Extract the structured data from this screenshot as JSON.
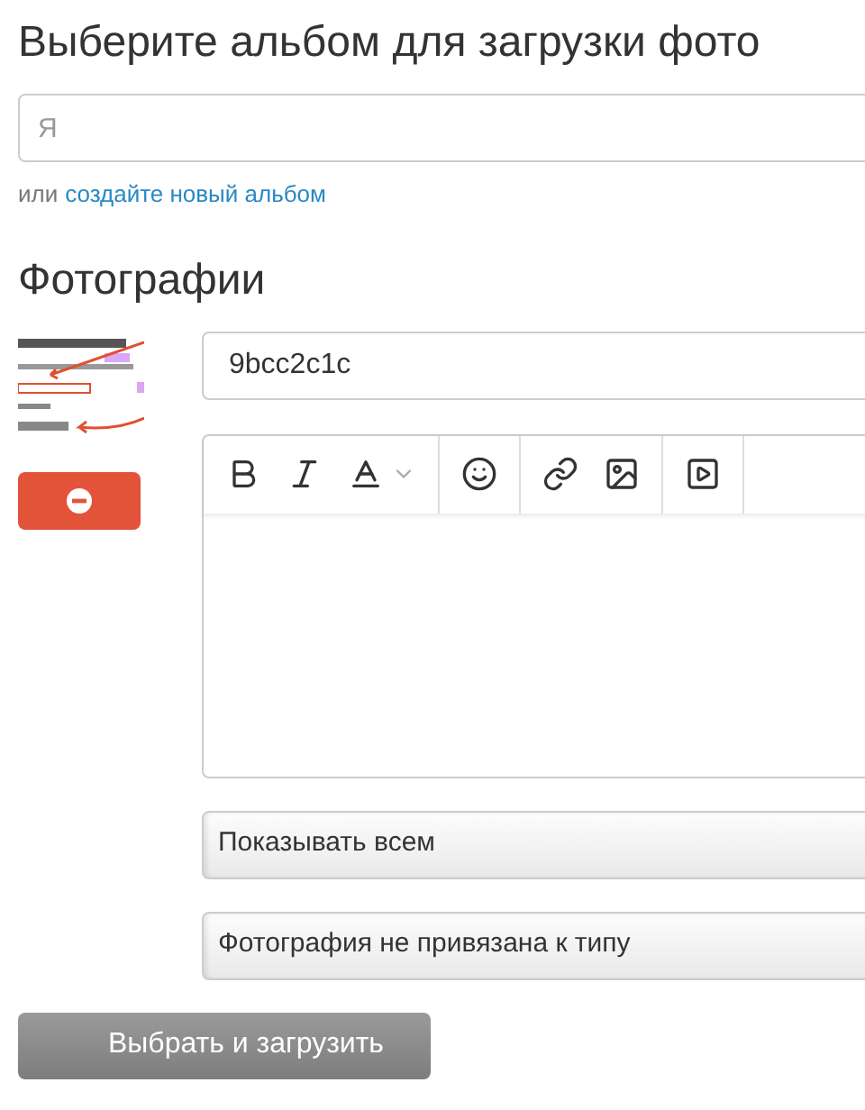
{
  "title": "Выберите альбом для загрузки фото",
  "album_field": {
    "placeholder": "Я"
  },
  "create_hint": {
    "prefix": "или",
    "link": "создайте новый альбом"
  },
  "photos_heading": "Фотографии",
  "photo": {
    "title": "9bcc2c1c"
  },
  "selects": [
    {
      "value": "Показывать всем"
    },
    {
      "value": "Фотография не привязана к типу"
    }
  ],
  "submit": "Выбрать и загрузить"
}
